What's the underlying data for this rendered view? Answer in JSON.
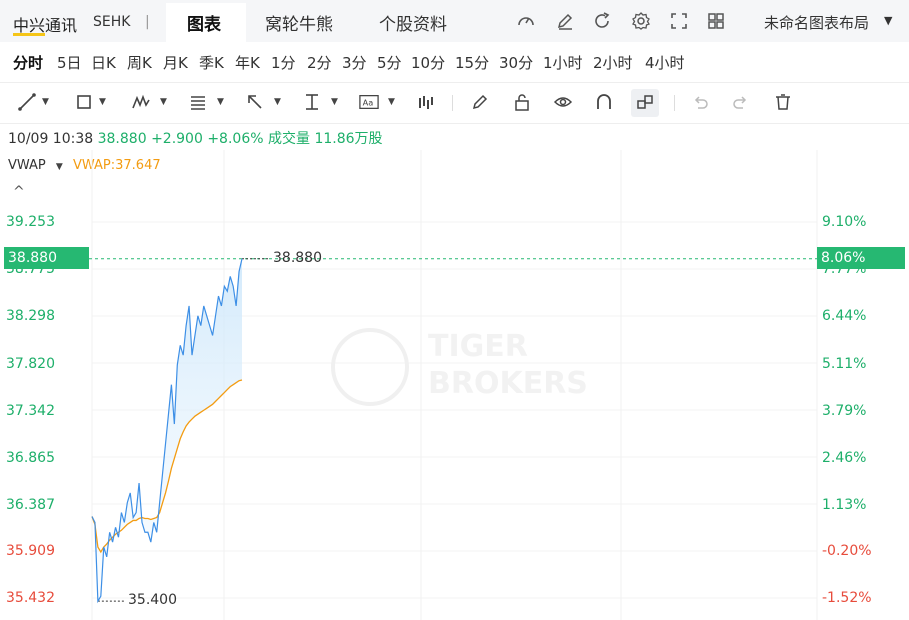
{
  "header": {
    "stock_name": "中兴通讯",
    "stock_code": "SEHK",
    "separator": "|",
    "tabs": [
      {
        "label": "图表",
        "active": true
      },
      {
        "label": "窝轮牛熊",
        "active": false
      },
      {
        "label": "个股资料",
        "active": false
      }
    ],
    "toolbar_icons": [
      "speedometer-icon",
      "edit-icon",
      "refresh-icon",
      "settings-icon",
      "fullscreen-icon",
      "grid-layout-icon"
    ],
    "layout_name": "未命名图表布局",
    "layout_caret": "▼"
  },
  "periods": [
    {
      "label": "分时",
      "active": true
    },
    {
      "label": "5日"
    },
    {
      "label": "日K"
    },
    {
      "label": "周K"
    },
    {
      "label": "月K"
    },
    {
      "label": "季K"
    },
    {
      "label": "年K"
    },
    {
      "label": "1分"
    },
    {
      "label": "2分"
    },
    {
      "label": "3分"
    },
    {
      "label": "5分"
    },
    {
      "label": "10分"
    },
    {
      "label": "15分"
    },
    {
      "label": "30分"
    },
    {
      "label": "1小时"
    },
    {
      "label": "2小时"
    },
    {
      "label": "4小时"
    }
  ],
  "quote": {
    "datetime": "10/09 10:38",
    "price": "38.880",
    "change": "+2.900",
    "change_pct": "+8.06%",
    "volume_label": "成交量",
    "volume": "11.86万股"
  },
  "indicator": {
    "name": "VWAP",
    "caret": "▼",
    "value_text": "VWAP:37.647"
  },
  "axis": {
    "price_labels": [
      "39.253",
      "38.775",
      "38.298",
      "37.820",
      "37.342",
      "36.865",
      "36.387",
      "35.909",
      "35.432"
    ],
    "pct_labels": [
      "9.10%",
      "7.77%",
      "6.44%",
      "5.11%",
      "3.79%",
      "2.46%",
      "1.13%",
      "-0.20%",
      "-1.52%"
    ],
    "current_price_tag": "38.880",
    "current_pct_tag": "8.06%",
    "high_label": "38.880",
    "low_label": "35.400"
  },
  "watermark": {
    "line1": "TIGER",
    "line2": "BROKERS"
  },
  "colors": {
    "up": "#1eaf6a",
    "down": "#e74c3c",
    "price_line": "#3d8fe6",
    "vwap_line": "#f39c12",
    "tag_bg": "#26b872",
    "active_underline": "#f5c518"
  },
  "chart_data": {
    "type": "line",
    "ylim": [
      35.432,
      39.253
    ],
    "prev_close": 35.98,
    "series": [
      {
        "name": "",
        "values": [
          36.26,
          36.2,
          35.4,
          35.45,
          35.95,
          35.85,
          36.1,
          36.0,
          36.15,
          36.05,
          36.3,
          36.2,
          36.4,
          36.5,
          36.25,
          36.3,
          36.6,
          36.2,
          36.1,
          36.1,
          36.0,
          36.2,
          36.1,
          36.4,
          36.7,
          37.0,
          37.3,
          37.6,
          37.2,
          37.8,
          38.0,
          37.9,
          38.2,
          38.4,
          37.9,
          38.1,
          38.3,
          38.2,
          38.4,
          38.3,
          38.2,
          38.1,
          38.3,
          38.5,
          38.4,
          38.6,
          38.55,
          38.7,
          38.6,
          38.4,
          38.75,
          38.88
        ]
      },
      {
        "name": "VWAP",
        "values": [
          36.26,
          36.18,
          35.95,
          35.9,
          35.95,
          35.98,
          36.02,
          36.05,
          36.08,
          36.1,
          36.12,
          36.15,
          36.18,
          36.2,
          36.22,
          36.22,
          36.24,
          36.25,
          36.24,
          36.24,
          36.23,
          36.24,
          36.25,
          36.3,
          36.4,
          36.5,
          36.62,
          36.75,
          36.85,
          36.95,
          37.05,
          37.12,
          37.18,
          37.22,
          37.25,
          37.28,
          37.3,
          37.32,
          37.34,
          37.36,
          37.38,
          37.4,
          37.43,
          37.46,
          37.49,
          37.52,
          37.55,
          37.58,
          37.6,
          37.62,
          37.64,
          37.647
        ]
      }
    ]
  }
}
